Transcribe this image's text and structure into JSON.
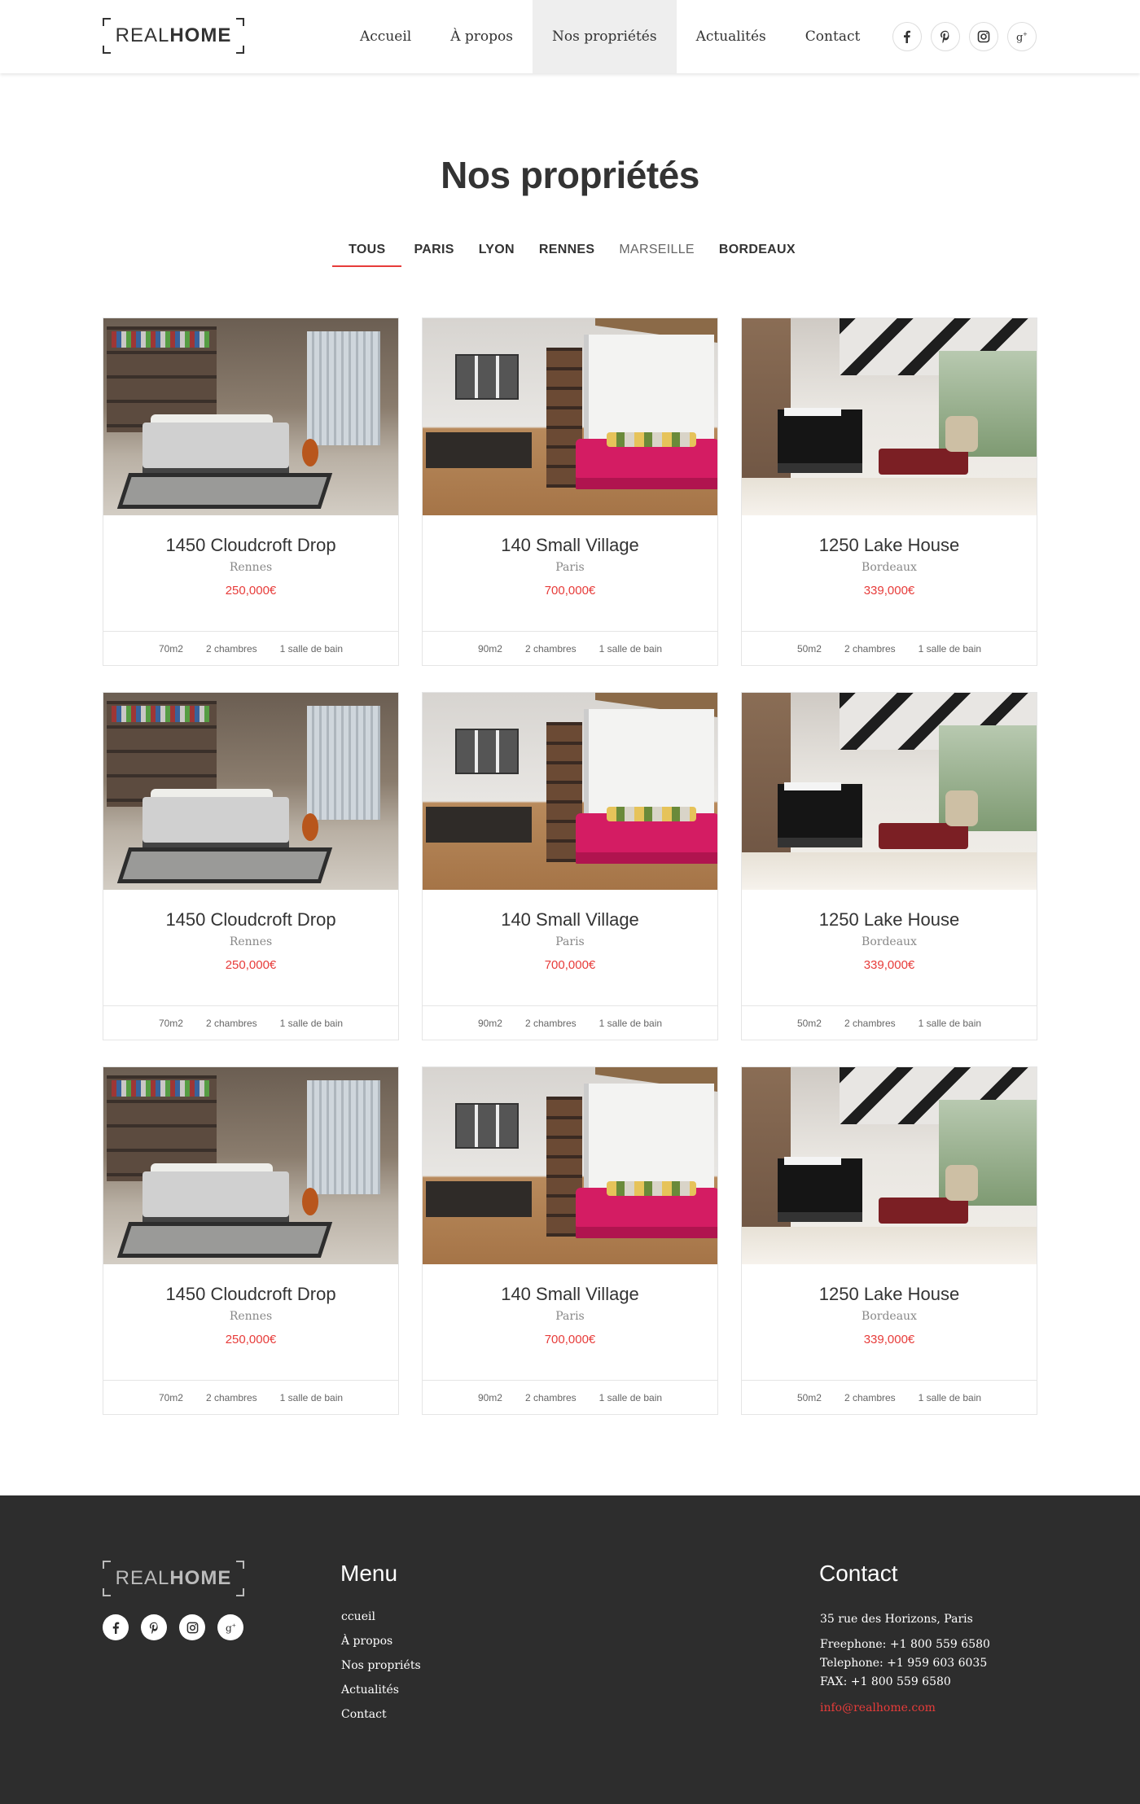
{
  "header": {
    "logo": {
      "light": "REAL",
      "bold": "HOME"
    },
    "nav": [
      {
        "label": "Accueil",
        "active": false
      },
      {
        "label": "À propos",
        "active": false
      },
      {
        "label": "Nos propriétés",
        "active": true
      },
      {
        "label": "Actualités",
        "active": false
      },
      {
        "label": "Contact",
        "active": false
      }
    ],
    "social_icons": [
      "facebook-icon",
      "pinterest-icon",
      "instagram-icon",
      "google-plus-icon"
    ]
  },
  "page": {
    "title": "Nos propriétés",
    "filters": [
      {
        "label": "TOUS",
        "active": true
      },
      {
        "label": "PARIS"
      },
      {
        "label": "LYON"
      },
      {
        "label": "RENNES"
      },
      {
        "label": "MARSEILLE"
      },
      {
        "label": "BORDEAUX"
      }
    ]
  },
  "listings": [
    {
      "name": "1450 Cloudcroft Drop",
      "city": "Rennes",
      "price": "250,000€",
      "area": "70m2",
      "bedrooms": "2 chambres",
      "bathrooms": "1 salle de bain",
      "photo": "bedroom"
    },
    {
      "name": "140 Small Village",
      "city": "Paris",
      "price": "700,000€",
      "area": "90m2",
      "bedrooms": "2 chambres",
      "bathrooms": "1 salle de bain",
      "photo": "studio"
    },
    {
      "name": "1250 Lake House",
      "city": "Bordeaux",
      "price": "339,000€",
      "area": "50m2",
      "bedrooms": "2 chambres",
      "bathrooms": "1 salle de bain",
      "photo": "living"
    },
    {
      "name": "1450 Cloudcroft Drop",
      "city": "Rennes",
      "price": "250,000€",
      "area": "70m2",
      "bedrooms": "2 chambres",
      "bathrooms": "1 salle de bain",
      "photo": "bedroom"
    },
    {
      "name": "140 Small Village",
      "city": "Paris",
      "price": "700,000€",
      "area": "90m2",
      "bedrooms": "2 chambres",
      "bathrooms": "1 salle de bain",
      "photo": "studio"
    },
    {
      "name": "1250 Lake House",
      "city": "Bordeaux",
      "price": "339,000€",
      "area": "50m2",
      "bedrooms": "2 chambres",
      "bathrooms": "1 salle de bain",
      "photo": "living"
    },
    {
      "name": "1450 Cloudcroft Drop",
      "city": "Rennes",
      "price": "250,000€",
      "area": "70m2",
      "bedrooms": "2 chambres",
      "bathrooms": "1 salle de bain",
      "photo": "bedroom"
    },
    {
      "name": "140 Small Village",
      "city": "Paris",
      "price": "700,000€",
      "area": "90m2",
      "bedrooms": "2 chambres",
      "bathrooms": "1 salle de bain",
      "photo": "studio"
    },
    {
      "name": "1250 Lake House",
      "city": "Bordeaux",
      "price": "339,000€",
      "area": "50m2",
      "bedrooms": "2 chambres",
      "bathrooms": "1 salle de bain",
      "photo": "living"
    }
  ],
  "footer": {
    "logo": {
      "light": "REAL",
      "bold": "HOME"
    },
    "menu_title": "Menu",
    "menu": [
      "ccueil",
      "À propos",
      "Nos propriéts",
      "Actualités",
      "Contact"
    ],
    "contact_title": "Contact",
    "address": "35 rue des Horizons, Paris",
    "freephone": "Freephone: +1 800 559 6580",
    "telephone": "Telephone: +1 959 603 6035",
    "fax": "FAX: +1 800 559 6580",
    "email": "info@realhome.com"
  },
  "colors": {
    "accent": "#e73c3a",
    "footer_bg": "#2d2d2d",
    "nav_active_bg": "#eeeeee"
  }
}
